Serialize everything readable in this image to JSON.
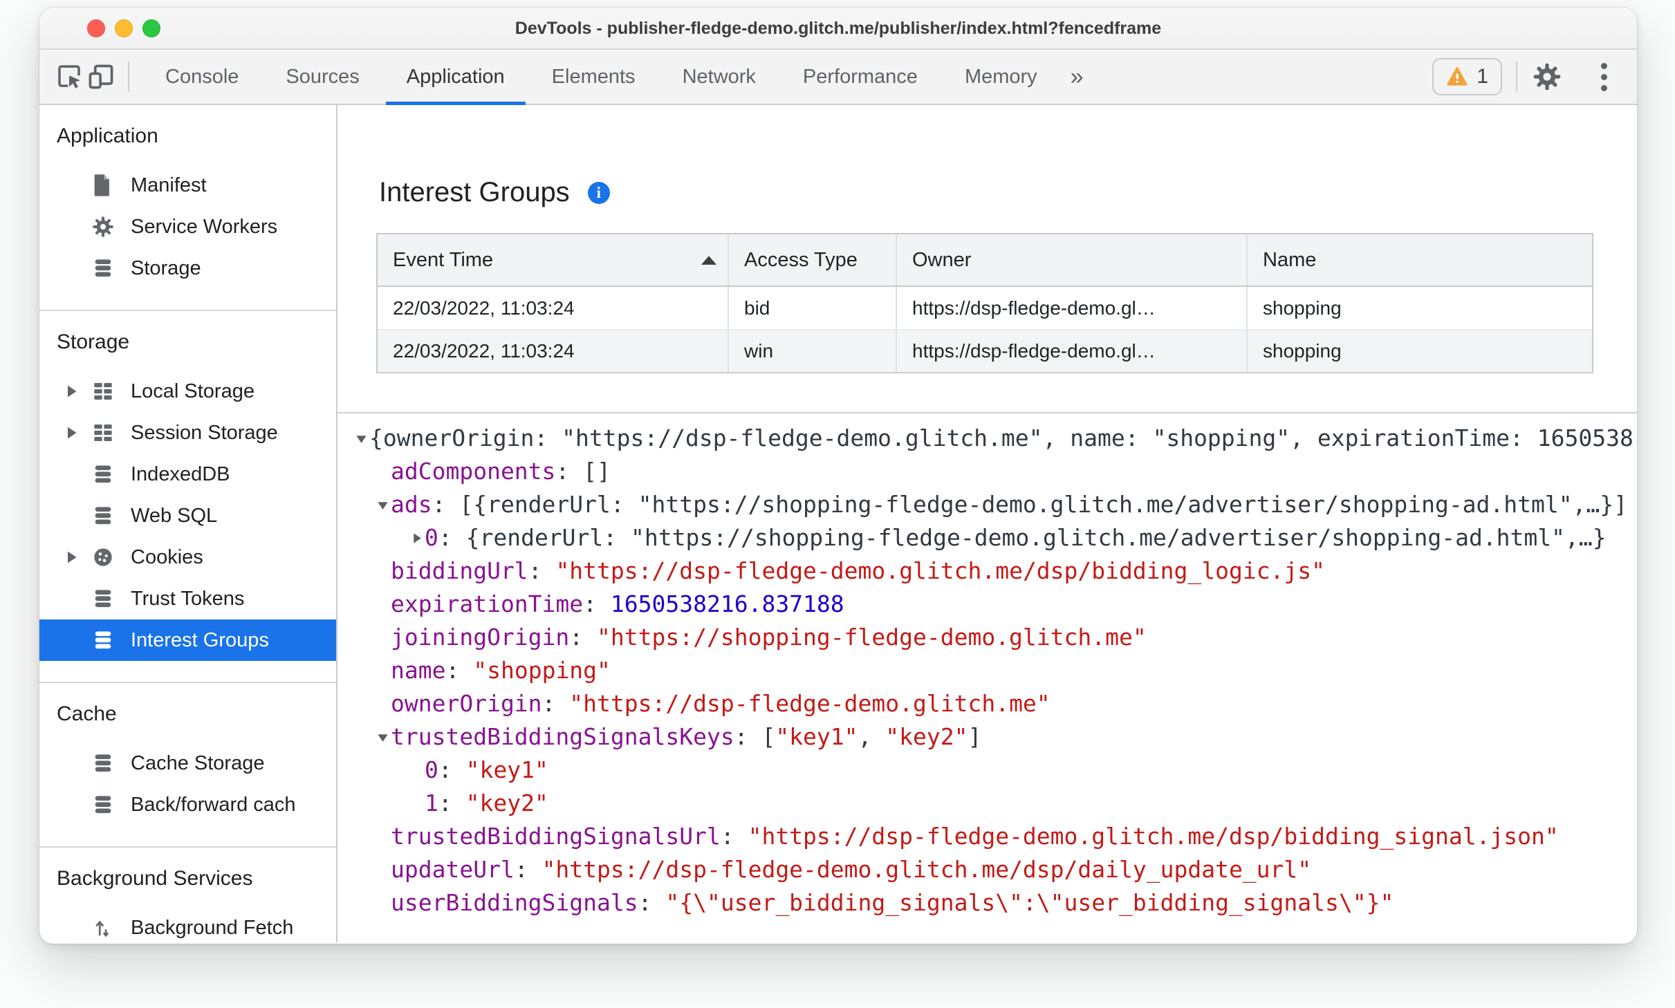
{
  "window": {
    "title": "DevTools - publisher-fledge-demo.glitch.me/publisher/index.html?fencedframe"
  },
  "toolbar": {
    "tabs": [
      "Console",
      "Sources",
      "Application",
      "Elements",
      "Network",
      "Performance",
      "Memory"
    ],
    "active_tab": "Application",
    "more_tabs_glyph": "»",
    "warning_count": "1"
  },
  "sidebar": {
    "sections": [
      {
        "title": "Application",
        "items": [
          {
            "label": "Manifest",
            "icon": "document-icon"
          },
          {
            "label": "Service Workers",
            "icon": "gear-icon"
          },
          {
            "label": "Storage",
            "icon": "database-icon"
          }
        ]
      },
      {
        "title": "Storage",
        "items": [
          {
            "label": "Local Storage",
            "icon": "grid-icon",
            "expandable": true
          },
          {
            "label": "Session Storage",
            "icon": "grid-icon",
            "expandable": true
          },
          {
            "label": "IndexedDB",
            "icon": "database-icon"
          },
          {
            "label": "Web SQL",
            "icon": "database-icon"
          },
          {
            "label": "Cookies",
            "icon": "cookie-icon",
            "expandable": true
          },
          {
            "label": "Trust Tokens",
            "icon": "database-icon"
          },
          {
            "label": "Interest Groups",
            "icon": "database-icon",
            "selected": true
          }
        ]
      },
      {
        "title": "Cache",
        "items": [
          {
            "label": "Cache Storage",
            "icon": "database-icon"
          },
          {
            "label": "Back/forward cach",
            "icon": "database-icon"
          }
        ]
      },
      {
        "title": "Background Services",
        "items": [
          {
            "label": "Background Fetch",
            "icon": "fetch-icon"
          }
        ]
      }
    ]
  },
  "main": {
    "title": "Interest Groups",
    "info_glyph": "i",
    "table": {
      "columns": [
        "Event Time",
        "Access Type",
        "Owner",
        "Name"
      ],
      "sorted_column": "Event Time",
      "sort_direction": "asc",
      "rows": [
        [
          "22/03/2022, 11:03:24",
          "bid",
          "https://dsp-fledge-demo.gl…",
          "shopping"
        ],
        [
          "22/03/2022, 11:03:24",
          "win",
          "https://dsp-fledge-demo.gl…",
          "shopping"
        ]
      ]
    },
    "tree": {
      "lines": [
        {
          "indent": 0,
          "marker": "expanded",
          "segments": [
            {
              "c": "p",
              "t": "{ownerOrigin: \"https://dsp-fledge-demo.glitch.me\", name: \"shopping\", expirationTime: 1650538"
            }
          ]
        },
        {
          "indent": 1,
          "marker": null,
          "segments": [
            {
              "c": "k",
              "t": "adComponents"
            },
            {
              "c": "p",
              "t": ": []"
            }
          ]
        },
        {
          "indent": 1,
          "marker": "expanded",
          "segments": [
            {
              "c": "k",
              "t": "ads"
            },
            {
              "c": "p",
              "t": ": [{renderUrl: \"https://shopping-fledge-demo.glitch.me/advertiser/shopping-ad.html\",…}]"
            }
          ]
        },
        {
          "indent": 2,
          "marker": "collapsed",
          "segments": [
            {
              "c": "k",
              "t": "0"
            },
            {
              "c": "p",
              "t": ": {renderUrl: \"https://shopping-fledge-demo.glitch.me/advertiser/shopping-ad.html\",…}"
            }
          ]
        },
        {
          "indent": 1,
          "marker": null,
          "segments": [
            {
              "c": "k",
              "t": "biddingUrl"
            },
            {
              "c": "p",
              "t": ": "
            },
            {
              "c": "s",
              "t": "\"https://dsp-fledge-demo.glitch.me/dsp/bidding_logic.js\""
            }
          ]
        },
        {
          "indent": 1,
          "marker": null,
          "segments": [
            {
              "c": "k",
              "t": "expirationTime"
            },
            {
              "c": "p",
              "t": ": "
            },
            {
              "c": "n",
              "t": "1650538216.837188"
            }
          ]
        },
        {
          "indent": 1,
          "marker": null,
          "segments": [
            {
              "c": "k",
              "t": "joiningOrigin"
            },
            {
              "c": "p",
              "t": ": "
            },
            {
              "c": "s",
              "t": "\"https://shopping-fledge-demo.glitch.me\""
            }
          ]
        },
        {
          "indent": 1,
          "marker": null,
          "segments": [
            {
              "c": "k",
              "t": "name"
            },
            {
              "c": "p",
              "t": ": "
            },
            {
              "c": "s",
              "t": "\"shopping\""
            }
          ]
        },
        {
          "indent": 1,
          "marker": null,
          "segments": [
            {
              "c": "k",
              "t": "ownerOrigin"
            },
            {
              "c": "p",
              "t": ": "
            },
            {
              "c": "s",
              "t": "\"https://dsp-fledge-demo.glitch.me\""
            }
          ]
        },
        {
          "indent": 1,
          "marker": "expanded",
          "segments": [
            {
              "c": "k",
              "t": "trustedBiddingSignalsKeys"
            },
            {
              "c": "p",
              "t": ": ["
            },
            {
              "c": "s",
              "t": "\"key1\""
            },
            {
              "c": "p",
              "t": ", "
            },
            {
              "c": "s",
              "t": "\"key2\""
            },
            {
              "c": "p",
              "t": "]"
            }
          ]
        },
        {
          "indent": 2,
          "marker": null,
          "segments": [
            {
              "c": "k",
              "t": "0"
            },
            {
              "c": "p",
              "t": ": "
            },
            {
              "c": "s",
              "t": "\"key1\""
            }
          ]
        },
        {
          "indent": 2,
          "marker": null,
          "segments": [
            {
              "c": "k",
              "t": "1"
            },
            {
              "c": "p",
              "t": ": "
            },
            {
              "c": "s",
              "t": "\"key2\""
            }
          ]
        },
        {
          "indent": 1,
          "marker": null,
          "segments": [
            {
              "c": "k",
              "t": "trustedBiddingSignalsUrl"
            },
            {
              "c": "p",
              "t": ": "
            },
            {
              "c": "s",
              "t": "\"https://dsp-fledge-demo.glitch.me/dsp/bidding_signal.json\""
            }
          ]
        },
        {
          "indent": 1,
          "marker": null,
          "segments": [
            {
              "c": "k",
              "t": "updateUrl"
            },
            {
              "c": "p",
              "t": ": "
            },
            {
              "c": "s",
              "t": "\"https://dsp-fledge-demo.glitch.me/dsp/daily_update_url\""
            }
          ]
        },
        {
          "indent": 1,
          "marker": null,
          "segments": [
            {
              "c": "k",
              "t": "userBiddingSignals"
            },
            {
              "c": "p",
              "t": ": "
            },
            {
              "c": "s",
              "t": "\"{\\\"user_bidding_signals\\\":\\\"user_bidding_signals\\\"}\""
            }
          ]
        }
      ]
    }
  },
  "colors": {
    "accent_blue": "#1a73e8",
    "key_purple": "#881391",
    "string_red": "#c41a16",
    "number_blue": "#1c00cf",
    "plain_text": "#303942",
    "warning_yellow": "#f0a43a",
    "close_red": "#ff5f57",
    "minimize_yellow": "#febc2e",
    "zoom_green": "#28c840"
  }
}
